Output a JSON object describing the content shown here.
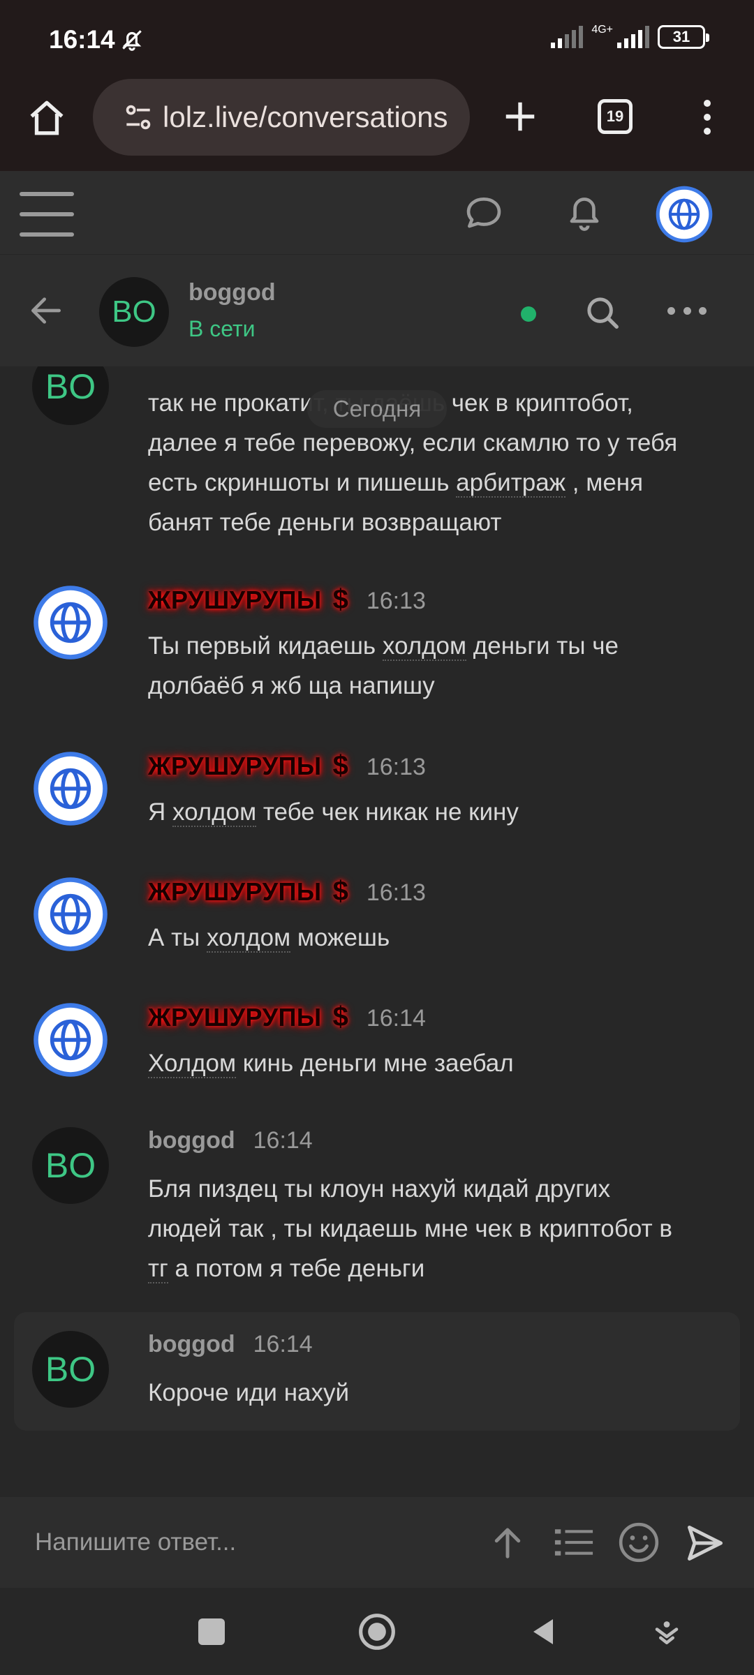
{
  "status_bar": {
    "time": "16:14",
    "network": "4G+",
    "battery": "31"
  },
  "browser": {
    "url": "lolz.live/conversations",
    "tab_count": "19"
  },
  "conversation": {
    "name": "boggod",
    "status": "В сети",
    "status_color": "#3ec785"
  },
  "date_divider": "Сегодня",
  "messages": [
    {
      "author": "",
      "time": "",
      "avatar": "BO",
      "lines": [
        "так не прокатит, ты даёшь чек в криптобот,",
        "далее я тебе перевожу, если скамлю то у тебя",
        "есть скриншоты и пишешь ",
        "арбитраж",
        " , меня",
        "банят тебе деньги возвращают"
      ]
    },
    {
      "author": "ЖРУШУРУПЫ",
      "time": "16:13",
      "text_a": "Ты первый кидаешь ",
      "text_ul": "холдом",
      "text_b": " деньги ты че",
      "text_c": "долбаёб я жб ща напишу"
    },
    {
      "author": "ЖРУШУРУПЫ",
      "time": "16:13",
      "text_a": "Я ",
      "text_ul": "холдом",
      "text_b": " тебе чек никак не кину"
    },
    {
      "author": "ЖРУШУРУПЫ",
      "time": "16:13",
      "text_a": "А ты ",
      "text_ul": "холдом",
      "text_b": " можешь"
    },
    {
      "author": "ЖРУШУРУПЫ",
      "time": "16:14",
      "text_ul": "Холдом",
      "text_b": " кинь деньги мне заебал"
    },
    {
      "author": "boggod",
      "time": "16:14",
      "avatar": "BO",
      "line1": "Бля пиздец ты клоун нахуй кидай других",
      "line2": "людей так , ты кидаешь мне чек в криптобот в",
      "line3_ul": "тг",
      "line3_rest": " а потом я тебе деньги"
    },
    {
      "author": "boggod",
      "time": "16:14",
      "avatar": "BO",
      "text": "Короче иди нахуй"
    }
  ],
  "reply": {
    "placeholder": "Напишите ответ..."
  },
  "colors": {
    "accent_green": "#3ec785",
    "author_glow": "#ff1d1d",
    "background": "#272727"
  }
}
